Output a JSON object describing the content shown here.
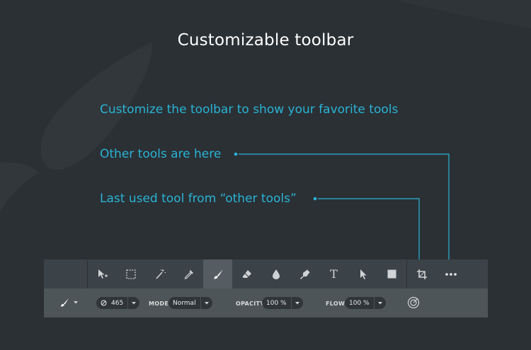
{
  "header": {
    "title": "Customizable toolbar"
  },
  "captions": {
    "customize": "Customize the toolbar to show your favorite tools",
    "other_tools": "Other tools are here",
    "last_used": "Last used tool from “other tools”"
  },
  "colors": {
    "background": "#2b3034",
    "accent": "#29b3d6",
    "toolbar": "#3c4348",
    "options_bar": "#4e5558",
    "active_tool": "#555d62"
  },
  "toolbar": {
    "tools": [
      {
        "name": "move-tool",
        "icon": "move-arrow-icon"
      },
      {
        "name": "rect-select-tool",
        "icon": "marquee-icon"
      },
      {
        "name": "magic-wand-tool",
        "icon": "magic-wand-icon"
      },
      {
        "name": "eyedropper-tool",
        "icon": "eyedropper-icon"
      },
      {
        "name": "brush-tool",
        "icon": "brush-icon",
        "active": true
      },
      {
        "name": "eraser-tool",
        "icon": "eraser-icon"
      },
      {
        "name": "blur-tool",
        "icon": "drop-icon"
      },
      {
        "name": "pen-tool",
        "icon": "pen-nib-icon"
      },
      {
        "name": "text-tool",
        "icon": "text-icon"
      },
      {
        "name": "select-tool",
        "icon": "pointer-icon"
      },
      {
        "name": "shape-tool",
        "icon": "square-icon"
      },
      {
        "name": "crop-tool",
        "icon": "crop-icon"
      },
      {
        "name": "more-tools",
        "icon": "more-dots-icon"
      }
    ],
    "text_tool_glyph": "T"
  },
  "options": {
    "size_value": "465",
    "mode_label": "MODE",
    "mode_value": "Normal",
    "opacity_label": "OPACITY",
    "opacity_value": "100 %",
    "flow_label": "FLOW",
    "flow_value": "100 %"
  }
}
